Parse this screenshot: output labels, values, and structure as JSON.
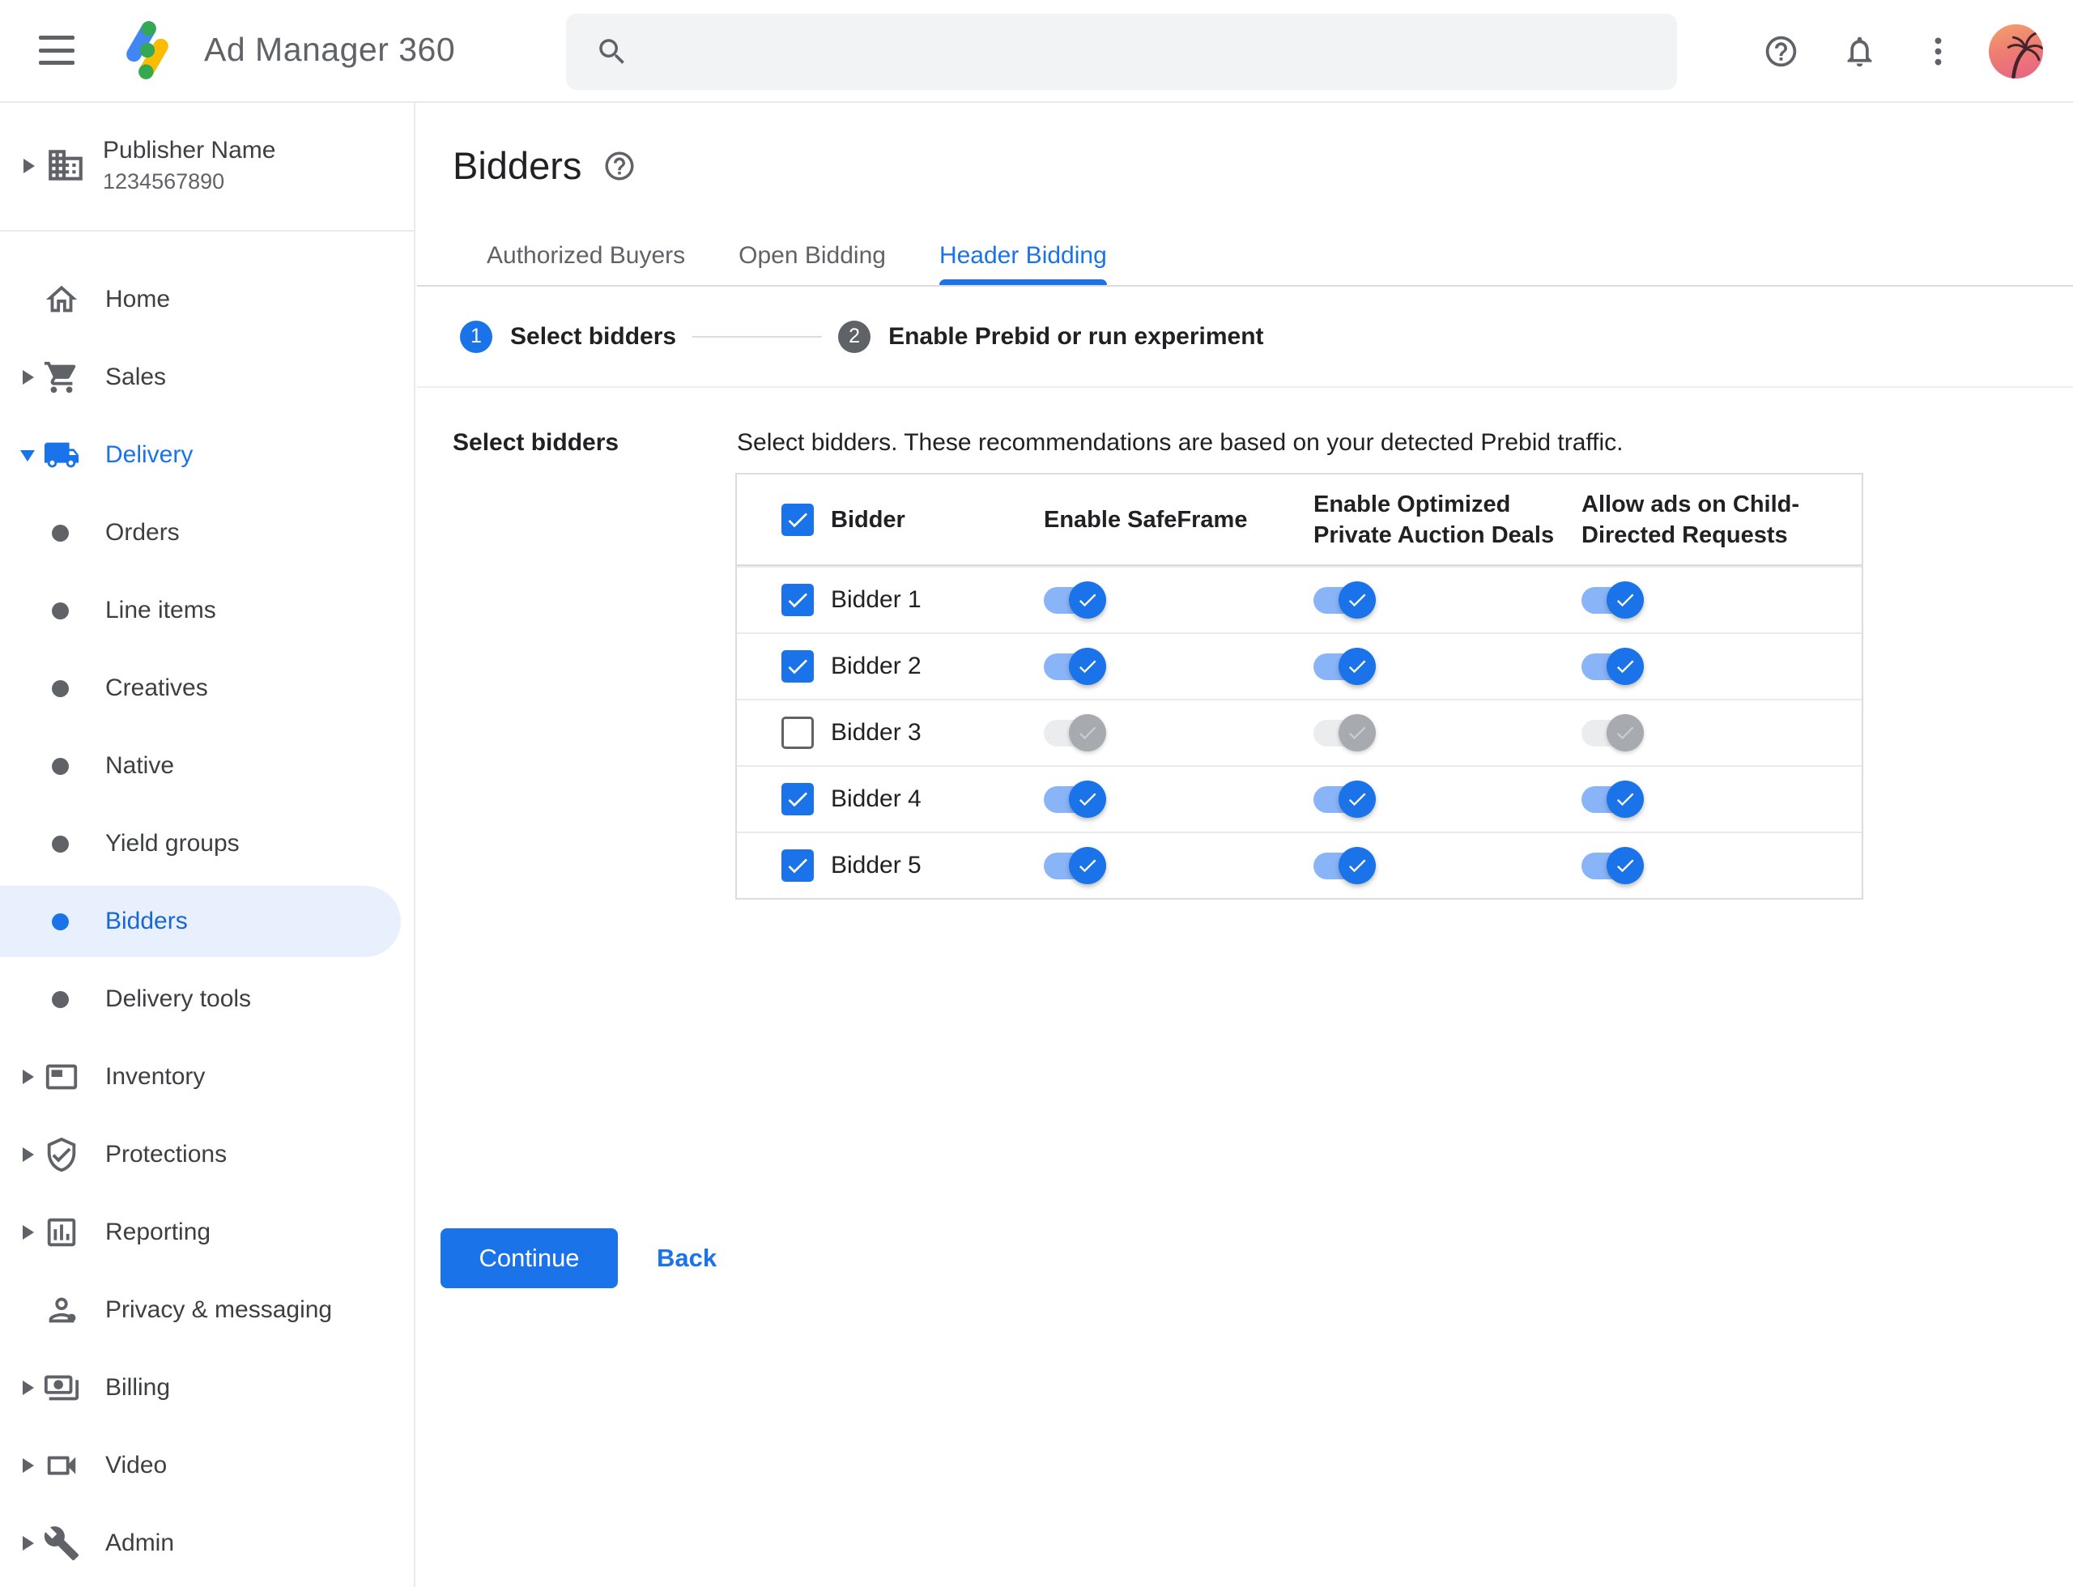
{
  "header": {
    "app_title": "Ad Manager 360",
    "search": {
      "value": "",
      "placeholder": ""
    },
    "icons": [
      "menu-icon",
      "ad-manager-logo",
      "search-icon",
      "help-icon",
      "notifications-icon",
      "more-vertical-icon",
      "avatar"
    ]
  },
  "sidebar": {
    "publisher": {
      "name": "Publisher Name",
      "id": "1234567890",
      "icon": "building"
    },
    "items": [
      {
        "label": "Home",
        "icon": "home"
      },
      {
        "label": "Sales",
        "icon": "cart",
        "expandable": true
      },
      {
        "label": "Delivery",
        "icon": "truck",
        "expandable": true,
        "expanded": true,
        "highlight": "blue"
      },
      {
        "label": "Orders",
        "type": "sub"
      },
      {
        "label": "Line items",
        "type": "sub"
      },
      {
        "label": "Creatives",
        "type": "sub"
      },
      {
        "label": "Native",
        "type": "sub"
      },
      {
        "label": "Yield groups",
        "type": "sub"
      },
      {
        "label": "Bidders",
        "type": "sub",
        "selected": true
      },
      {
        "label": "Delivery tools",
        "type": "sub"
      },
      {
        "label": "Inventory",
        "icon": "inventory",
        "expandable": true
      },
      {
        "label": "Protections",
        "icon": "shield",
        "expandable": true
      },
      {
        "label": "Reporting",
        "icon": "report",
        "expandable": true
      },
      {
        "label": "Privacy & messaging",
        "icon": "person"
      },
      {
        "label": "Billing",
        "icon": "money",
        "expandable": true
      },
      {
        "label": "Video",
        "icon": "video",
        "expandable": true
      },
      {
        "label": "Admin",
        "icon": "wrench",
        "expandable": true
      }
    ]
  },
  "page": {
    "title": "Bidders",
    "tabs": [
      {
        "label": "Authorized Buyers",
        "active": false
      },
      {
        "label": "Open Bidding",
        "active": false
      },
      {
        "label": "Header Bidding",
        "active": true
      }
    ],
    "stepper": {
      "steps": [
        {
          "number": "1",
          "label": "Select bidders",
          "active": true
        },
        {
          "number": "2",
          "label": "Enable Prebid or run experiment",
          "active": false
        }
      ]
    },
    "section_label": "Select bidders",
    "description": "Select bidders. These recommendations are based on your detected Prebid traffic.",
    "table": {
      "header_checkbox_checked": true,
      "columns": [
        "Bidder",
        "Enable SafeFrame",
        "Enable Optimized Private Auction Deals",
        "Allow ads on Child-Directed Requests"
      ],
      "rows": [
        {
          "name": "Bidder 1",
          "selected": true,
          "enable_safeframe": true,
          "enable_optimized_private_auction_deals": true,
          "allow_ads_child_directed": true
        },
        {
          "name": "Bidder 2",
          "selected": true,
          "enable_safeframe": true,
          "enable_optimized_private_auction_deals": true,
          "allow_ads_child_directed": true
        },
        {
          "name": "Bidder 3",
          "selected": false,
          "enable_safeframe": false,
          "enable_optimized_private_auction_deals": false,
          "allow_ads_child_directed": false
        },
        {
          "name": "Bidder 4",
          "selected": true,
          "enable_safeframe": true,
          "enable_optimized_private_auction_deals": true,
          "allow_ads_child_directed": true
        },
        {
          "name": "Bidder 5",
          "selected": true,
          "enable_safeframe": true,
          "enable_optimized_private_auction_deals": true,
          "allow_ads_child_directed": true
        }
      ]
    },
    "continue_label": "Continue",
    "back_label": "Back"
  },
  "colors": {
    "primary_blue": "#1a73e8",
    "selected_item_bg": "#e8f0fe",
    "selected_item_text": "#1967d2",
    "text_dark": "#202124",
    "text_gray": "#5f6368",
    "border": "#dadce0",
    "search_bg": "#f1f3f4",
    "toggle_on_track": "#8ab4f8",
    "toggle_off_track": "#ebecee",
    "toggle_off_thumb": "#a7abb0",
    "step_inactive": "#5f6368"
  }
}
